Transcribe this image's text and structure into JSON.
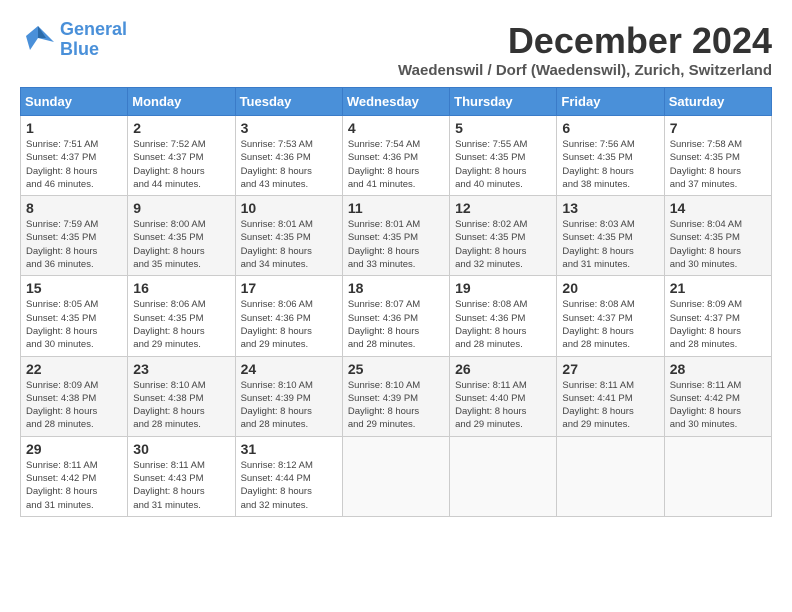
{
  "logo": {
    "line1": "General",
    "line2": "Blue"
  },
  "title": "December 2024",
  "subtitle": "Waedenswil / Dorf (Waedenswil), Zurich, Switzerland",
  "weekdays": [
    "Sunday",
    "Monday",
    "Tuesday",
    "Wednesday",
    "Thursday",
    "Friday",
    "Saturday"
  ],
  "weeks": [
    [
      {
        "day": "1",
        "info": "Sunrise: 7:51 AM\nSunset: 4:37 PM\nDaylight: 8 hours\nand 46 minutes."
      },
      {
        "day": "2",
        "info": "Sunrise: 7:52 AM\nSunset: 4:37 PM\nDaylight: 8 hours\nand 44 minutes."
      },
      {
        "day": "3",
        "info": "Sunrise: 7:53 AM\nSunset: 4:36 PM\nDaylight: 8 hours\nand 43 minutes."
      },
      {
        "day": "4",
        "info": "Sunrise: 7:54 AM\nSunset: 4:36 PM\nDaylight: 8 hours\nand 41 minutes."
      },
      {
        "day": "5",
        "info": "Sunrise: 7:55 AM\nSunset: 4:35 PM\nDaylight: 8 hours\nand 40 minutes."
      },
      {
        "day": "6",
        "info": "Sunrise: 7:56 AM\nSunset: 4:35 PM\nDaylight: 8 hours\nand 38 minutes."
      },
      {
        "day": "7",
        "info": "Sunrise: 7:58 AM\nSunset: 4:35 PM\nDaylight: 8 hours\nand 37 minutes."
      }
    ],
    [
      {
        "day": "8",
        "info": "Sunrise: 7:59 AM\nSunset: 4:35 PM\nDaylight: 8 hours\nand 36 minutes."
      },
      {
        "day": "9",
        "info": "Sunrise: 8:00 AM\nSunset: 4:35 PM\nDaylight: 8 hours\nand 35 minutes."
      },
      {
        "day": "10",
        "info": "Sunrise: 8:01 AM\nSunset: 4:35 PM\nDaylight: 8 hours\nand 34 minutes."
      },
      {
        "day": "11",
        "info": "Sunrise: 8:01 AM\nSunset: 4:35 PM\nDaylight: 8 hours\nand 33 minutes."
      },
      {
        "day": "12",
        "info": "Sunrise: 8:02 AM\nSunset: 4:35 PM\nDaylight: 8 hours\nand 32 minutes."
      },
      {
        "day": "13",
        "info": "Sunrise: 8:03 AM\nSunset: 4:35 PM\nDaylight: 8 hours\nand 31 minutes."
      },
      {
        "day": "14",
        "info": "Sunrise: 8:04 AM\nSunset: 4:35 PM\nDaylight: 8 hours\nand 30 minutes."
      }
    ],
    [
      {
        "day": "15",
        "info": "Sunrise: 8:05 AM\nSunset: 4:35 PM\nDaylight: 8 hours\nand 30 minutes."
      },
      {
        "day": "16",
        "info": "Sunrise: 8:06 AM\nSunset: 4:35 PM\nDaylight: 8 hours\nand 29 minutes."
      },
      {
        "day": "17",
        "info": "Sunrise: 8:06 AM\nSunset: 4:36 PM\nDaylight: 8 hours\nand 29 minutes."
      },
      {
        "day": "18",
        "info": "Sunrise: 8:07 AM\nSunset: 4:36 PM\nDaylight: 8 hours\nand 28 minutes."
      },
      {
        "day": "19",
        "info": "Sunrise: 8:08 AM\nSunset: 4:36 PM\nDaylight: 8 hours\nand 28 minutes."
      },
      {
        "day": "20",
        "info": "Sunrise: 8:08 AM\nSunset: 4:37 PM\nDaylight: 8 hours\nand 28 minutes."
      },
      {
        "day": "21",
        "info": "Sunrise: 8:09 AM\nSunset: 4:37 PM\nDaylight: 8 hours\nand 28 minutes."
      }
    ],
    [
      {
        "day": "22",
        "info": "Sunrise: 8:09 AM\nSunset: 4:38 PM\nDaylight: 8 hours\nand 28 minutes."
      },
      {
        "day": "23",
        "info": "Sunrise: 8:10 AM\nSunset: 4:38 PM\nDaylight: 8 hours\nand 28 minutes."
      },
      {
        "day": "24",
        "info": "Sunrise: 8:10 AM\nSunset: 4:39 PM\nDaylight: 8 hours\nand 28 minutes."
      },
      {
        "day": "25",
        "info": "Sunrise: 8:10 AM\nSunset: 4:39 PM\nDaylight: 8 hours\nand 29 minutes."
      },
      {
        "day": "26",
        "info": "Sunrise: 8:11 AM\nSunset: 4:40 PM\nDaylight: 8 hours\nand 29 minutes."
      },
      {
        "day": "27",
        "info": "Sunrise: 8:11 AM\nSunset: 4:41 PM\nDaylight: 8 hours\nand 29 minutes."
      },
      {
        "day": "28",
        "info": "Sunrise: 8:11 AM\nSunset: 4:42 PM\nDaylight: 8 hours\nand 30 minutes."
      }
    ],
    [
      {
        "day": "29",
        "info": "Sunrise: 8:11 AM\nSunset: 4:42 PM\nDaylight: 8 hours\nand 31 minutes."
      },
      {
        "day": "30",
        "info": "Sunrise: 8:11 AM\nSunset: 4:43 PM\nDaylight: 8 hours\nand 31 minutes."
      },
      {
        "day": "31",
        "info": "Sunrise: 8:12 AM\nSunset: 4:44 PM\nDaylight: 8 hours\nand 32 minutes."
      },
      null,
      null,
      null,
      null
    ]
  ]
}
